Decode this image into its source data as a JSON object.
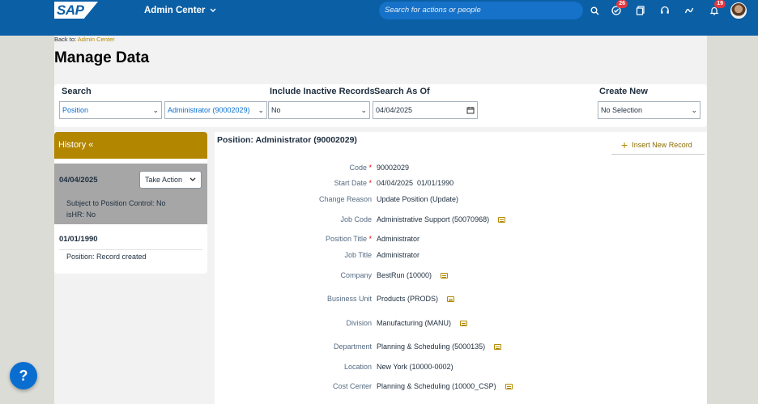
{
  "shell": {
    "logo": "SAP",
    "app_title": "Admin Center",
    "search_placeholder": "Search for actions or people",
    "notif_badge_1": "26",
    "notif_badge_2": "19"
  },
  "breadcrumb": {
    "prefix": "Back to:",
    "link": "Admin Center"
  },
  "page_title": "Manage Data",
  "filters": {
    "search_label": "Search",
    "search_type": "Position",
    "search_value": "Administrator (90002029)",
    "inactive_label": "Include Inactive Records",
    "inactive_value": "No",
    "as_of_label": "Search As Of",
    "as_of_value": "04/04/2025",
    "create_label": "Create New",
    "create_value": "No Selection"
  },
  "history": {
    "title": "History «",
    "entries": [
      {
        "date": "04/04/2025",
        "action_label": "Take Action",
        "lines": [
          "Subject to Position Control: No",
          "isHR: No"
        ]
      },
      {
        "date": "01/01/1990",
        "lines": [
          "Position: Record created"
        ]
      }
    ]
  },
  "detail": {
    "title": "Position: Administrator (90002029)",
    "insert_label": "Insert New Record",
    "fields": [
      {
        "label": "Code",
        "value": "90002029"
      },
      {
        "label": "Start Date",
        "value": "04/04/2025  01/01/1990"
      },
      {
        "label": "Change Reason",
        "value": "Update Position (Update)"
      },
      {
        "label": "Job Code",
        "value": "Administrative Support (50070968)"
      },
      {
        "label": "Position Title",
        "value": "Administrator"
      },
      {
        "label": "Job Title",
        "value": "Administrator"
      },
      {
        "label": "Company",
        "value": "BestRun (10000)"
      },
      {
        "label": "Business Unit",
        "value": "Products (PRODS)"
      },
      {
        "label": "Division",
        "value": "Manufacturing (MANU)"
      },
      {
        "label": "Department",
        "value": "Planning & Scheduling (5000135)"
      },
      {
        "label": "Location",
        "value": "New York (10000-0002)"
      },
      {
        "label": "Cost Center",
        "value": "Planning & Scheduling (10000_CSP)"
      }
    ]
  },
  "help_label": "?",
  "colors": {
    "shell": "#0b5fa5",
    "accent_gold": "#b38600",
    "link_blue": "#0a6ed1"
  }
}
